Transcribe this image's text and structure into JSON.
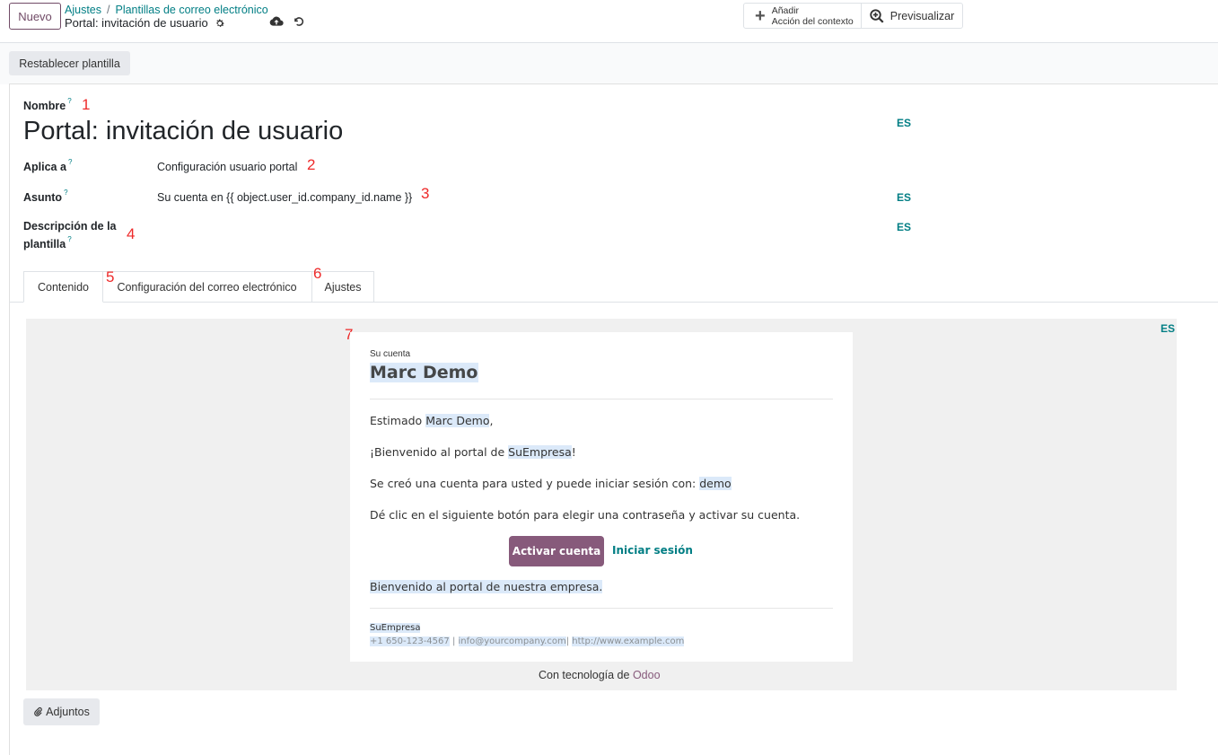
{
  "control_panel": {
    "new_button": "Nuevo",
    "breadcrumb": [
      "Ajustes",
      "Plantillas de correo electrónico"
    ],
    "breadcrumb_separator": "/",
    "record_title": "Portal: invitación de usuario",
    "add_action_line1": "Añadir",
    "add_action_line2": "Acción del contexto",
    "preview_label": "Previsualizar"
  },
  "status_bar": {
    "reset_button": "Restablecer plantilla"
  },
  "form": {
    "name_label": "Nombre",
    "name_value": "Portal: invitación de usuario",
    "applies_label": "Aplica a",
    "applies_value": "Configuración usuario portal",
    "subject_label": "Asunto",
    "subject_value": "Su cuenta en {{ object.user_id.company_id.name }}",
    "description_label_line1": "Descripción de la",
    "description_label_line2": "plantilla",
    "help_marker": "?",
    "lang_badge": "ES"
  },
  "annotations": [
    "1",
    "2",
    "3",
    "4",
    "5",
    "6",
    "7"
  ],
  "tabs": [
    {
      "label": "Contenido",
      "active": true
    },
    {
      "label": "Configuración del correo electrónico",
      "active": false
    },
    {
      "label": "Ajustes",
      "active": false
    }
  ],
  "email": {
    "header_small": "Su cuenta",
    "user_name": "Marc Demo",
    "greeting_prefix": "Estimado ",
    "greeting_name": "Marc Demo",
    "greeting_suffix": ",",
    "welcome_prefix": "¡Bienvenido al portal de ",
    "welcome_company": "SuEmpresa",
    "welcome_suffix": "!",
    "account_prefix": "Se creó una cuenta para usted y puede iniciar sesión con: ",
    "account_login": "demo",
    "instructions": "Dé clic en el siguiente botón para elegir una contraseña y activar su cuenta.",
    "activate_button": "Activar cuenta",
    "login_link": "Iniciar sesión",
    "closing": "Bienvenido al portal de nuestra empresa.",
    "footer_company": "SuEmpresa",
    "footer_phone": "+1 650-123-4567",
    "footer_sep": " | ",
    "footer_email": "info@yourcompany.com",
    "footer_sep2": "| ",
    "footer_web": "http://www.example.com",
    "powered_prefix": "Con tecnología de ",
    "powered_brand": "Odoo"
  },
  "attachments_button": "Adjuntos",
  "colors": {
    "accent": "#714b67",
    "link": "#017e84",
    "annotation": "#ee2a2a",
    "button": "#875a7b"
  }
}
